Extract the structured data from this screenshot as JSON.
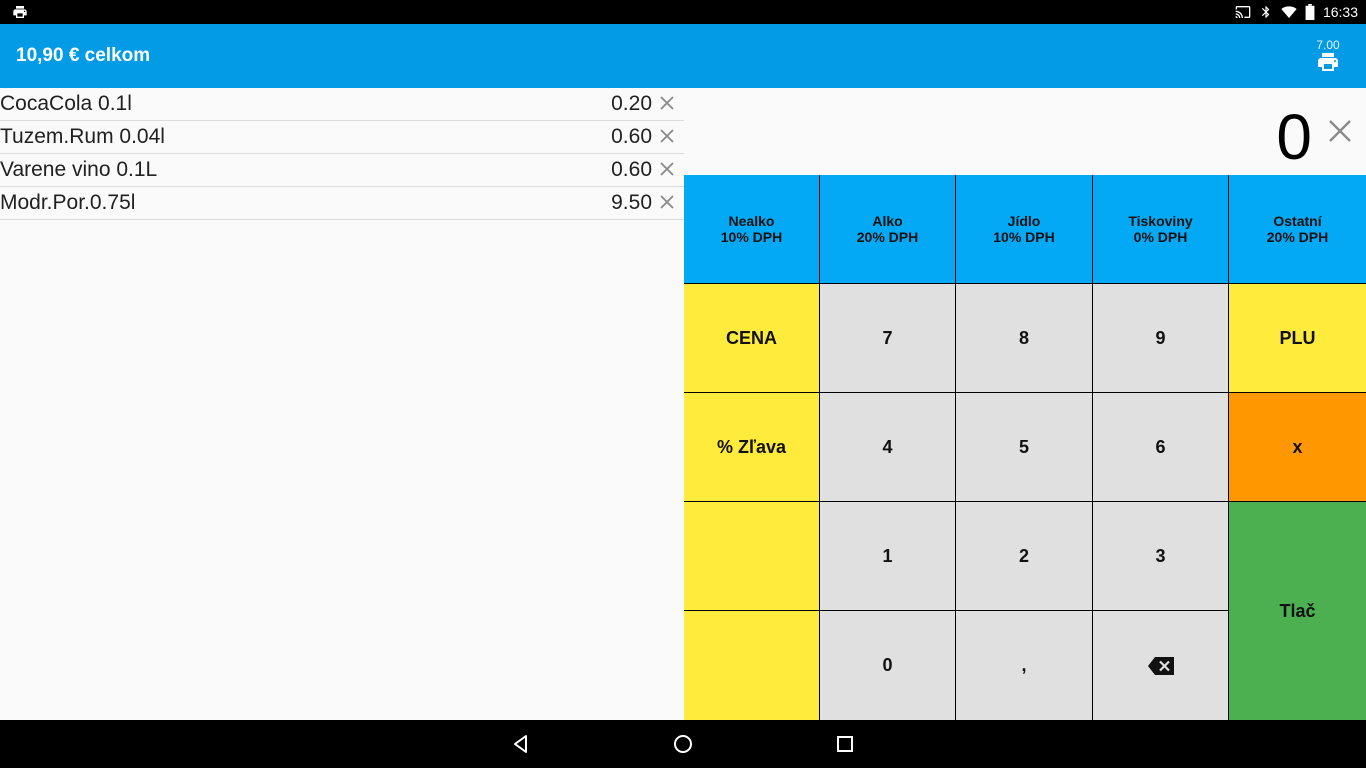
{
  "status_bar": {
    "time": "16:33"
  },
  "app_bar": {
    "total": "10,90 € celkom",
    "print_badge": "7.00"
  },
  "items": [
    {
      "name": "CocaCola 0.1l",
      "price": "0.20"
    },
    {
      "name": "Tuzem.Rum 0.04l",
      "price": "0.60"
    },
    {
      "name": "Varene vino 0.1L",
      "price": "0.60"
    },
    {
      "name": "Modr.Por.0.75l",
      "price": "9.50"
    }
  ],
  "display": {
    "value": "0"
  },
  "categories": [
    {
      "name": "Nealko",
      "vat": "10% DPH"
    },
    {
      "name": "Alko",
      "vat": "20% DPH"
    },
    {
      "name": "Jídlo",
      "vat": "10% DPH"
    },
    {
      "name": "Tiskoviny",
      "vat": "0% DPH"
    },
    {
      "name": "Ostatní",
      "vat": "20% DPH"
    }
  ],
  "keys": {
    "cena": "CENA",
    "discount": "% Zľava",
    "plu": "PLU",
    "multiply": "x",
    "print": "Tlač",
    "k7": "7",
    "k8": "8",
    "k9": "9",
    "k4": "4",
    "k5": "5",
    "k6": "6",
    "k1": "1",
    "k2": "2",
    "k3": "3",
    "k0": "0",
    "comma": ","
  },
  "colors": {
    "app_bar": "#039BE5",
    "category_key": "#03A9F4",
    "function_key": "#FFEB3B",
    "digit_key": "#E0E0E0",
    "multiply_key": "#FF9800",
    "print_key": "#4CAF50"
  }
}
